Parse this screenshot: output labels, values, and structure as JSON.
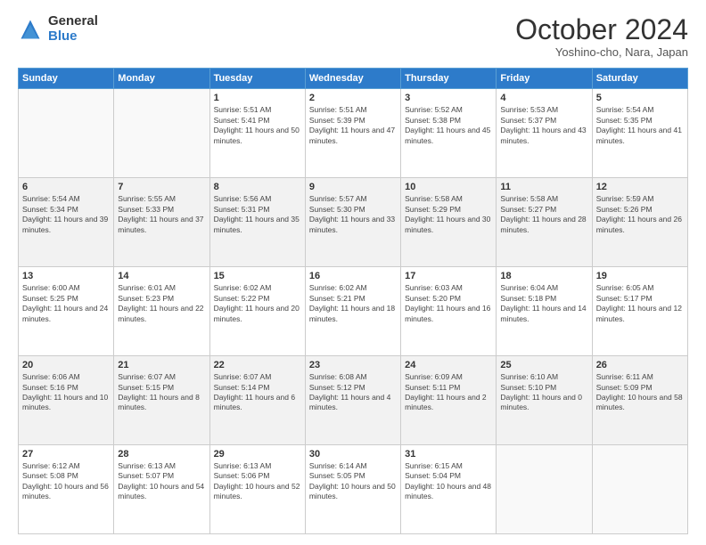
{
  "logo": {
    "general": "General",
    "blue": "Blue"
  },
  "title": "October 2024",
  "location": "Yoshino-cho, Nara, Japan",
  "days_of_week": [
    "Sunday",
    "Monday",
    "Tuesday",
    "Wednesday",
    "Thursday",
    "Friday",
    "Saturday"
  ],
  "weeks": [
    [
      {
        "day": "",
        "sunrise": "",
        "sunset": "",
        "daylight": ""
      },
      {
        "day": "",
        "sunrise": "",
        "sunset": "",
        "daylight": ""
      },
      {
        "day": "1",
        "sunrise": "Sunrise: 5:51 AM",
        "sunset": "Sunset: 5:41 PM",
        "daylight": "Daylight: 11 hours and 50 minutes."
      },
      {
        "day": "2",
        "sunrise": "Sunrise: 5:51 AM",
        "sunset": "Sunset: 5:39 PM",
        "daylight": "Daylight: 11 hours and 47 minutes."
      },
      {
        "day": "3",
        "sunrise": "Sunrise: 5:52 AM",
        "sunset": "Sunset: 5:38 PM",
        "daylight": "Daylight: 11 hours and 45 minutes."
      },
      {
        "day": "4",
        "sunrise": "Sunrise: 5:53 AM",
        "sunset": "Sunset: 5:37 PM",
        "daylight": "Daylight: 11 hours and 43 minutes."
      },
      {
        "day": "5",
        "sunrise": "Sunrise: 5:54 AM",
        "sunset": "Sunset: 5:35 PM",
        "daylight": "Daylight: 11 hours and 41 minutes."
      }
    ],
    [
      {
        "day": "6",
        "sunrise": "Sunrise: 5:54 AM",
        "sunset": "Sunset: 5:34 PM",
        "daylight": "Daylight: 11 hours and 39 minutes."
      },
      {
        "day": "7",
        "sunrise": "Sunrise: 5:55 AM",
        "sunset": "Sunset: 5:33 PM",
        "daylight": "Daylight: 11 hours and 37 minutes."
      },
      {
        "day": "8",
        "sunrise": "Sunrise: 5:56 AM",
        "sunset": "Sunset: 5:31 PM",
        "daylight": "Daylight: 11 hours and 35 minutes."
      },
      {
        "day": "9",
        "sunrise": "Sunrise: 5:57 AM",
        "sunset": "Sunset: 5:30 PM",
        "daylight": "Daylight: 11 hours and 33 minutes."
      },
      {
        "day": "10",
        "sunrise": "Sunrise: 5:58 AM",
        "sunset": "Sunset: 5:29 PM",
        "daylight": "Daylight: 11 hours and 30 minutes."
      },
      {
        "day": "11",
        "sunrise": "Sunrise: 5:58 AM",
        "sunset": "Sunset: 5:27 PM",
        "daylight": "Daylight: 11 hours and 28 minutes."
      },
      {
        "day": "12",
        "sunrise": "Sunrise: 5:59 AM",
        "sunset": "Sunset: 5:26 PM",
        "daylight": "Daylight: 11 hours and 26 minutes."
      }
    ],
    [
      {
        "day": "13",
        "sunrise": "Sunrise: 6:00 AM",
        "sunset": "Sunset: 5:25 PM",
        "daylight": "Daylight: 11 hours and 24 minutes."
      },
      {
        "day": "14",
        "sunrise": "Sunrise: 6:01 AM",
        "sunset": "Sunset: 5:23 PM",
        "daylight": "Daylight: 11 hours and 22 minutes."
      },
      {
        "day": "15",
        "sunrise": "Sunrise: 6:02 AM",
        "sunset": "Sunset: 5:22 PM",
        "daylight": "Daylight: 11 hours and 20 minutes."
      },
      {
        "day": "16",
        "sunrise": "Sunrise: 6:02 AM",
        "sunset": "Sunset: 5:21 PM",
        "daylight": "Daylight: 11 hours and 18 minutes."
      },
      {
        "day": "17",
        "sunrise": "Sunrise: 6:03 AM",
        "sunset": "Sunset: 5:20 PM",
        "daylight": "Daylight: 11 hours and 16 minutes."
      },
      {
        "day": "18",
        "sunrise": "Sunrise: 6:04 AM",
        "sunset": "Sunset: 5:18 PM",
        "daylight": "Daylight: 11 hours and 14 minutes."
      },
      {
        "day": "19",
        "sunrise": "Sunrise: 6:05 AM",
        "sunset": "Sunset: 5:17 PM",
        "daylight": "Daylight: 11 hours and 12 minutes."
      }
    ],
    [
      {
        "day": "20",
        "sunrise": "Sunrise: 6:06 AM",
        "sunset": "Sunset: 5:16 PM",
        "daylight": "Daylight: 11 hours and 10 minutes."
      },
      {
        "day": "21",
        "sunrise": "Sunrise: 6:07 AM",
        "sunset": "Sunset: 5:15 PM",
        "daylight": "Daylight: 11 hours and 8 minutes."
      },
      {
        "day": "22",
        "sunrise": "Sunrise: 6:07 AM",
        "sunset": "Sunset: 5:14 PM",
        "daylight": "Daylight: 11 hours and 6 minutes."
      },
      {
        "day": "23",
        "sunrise": "Sunrise: 6:08 AM",
        "sunset": "Sunset: 5:12 PM",
        "daylight": "Daylight: 11 hours and 4 minutes."
      },
      {
        "day": "24",
        "sunrise": "Sunrise: 6:09 AM",
        "sunset": "Sunset: 5:11 PM",
        "daylight": "Daylight: 11 hours and 2 minutes."
      },
      {
        "day": "25",
        "sunrise": "Sunrise: 6:10 AM",
        "sunset": "Sunset: 5:10 PM",
        "daylight": "Daylight: 11 hours and 0 minutes."
      },
      {
        "day": "26",
        "sunrise": "Sunrise: 6:11 AM",
        "sunset": "Sunset: 5:09 PM",
        "daylight": "Daylight: 10 hours and 58 minutes."
      }
    ],
    [
      {
        "day": "27",
        "sunrise": "Sunrise: 6:12 AM",
        "sunset": "Sunset: 5:08 PM",
        "daylight": "Daylight: 10 hours and 56 minutes."
      },
      {
        "day": "28",
        "sunrise": "Sunrise: 6:13 AM",
        "sunset": "Sunset: 5:07 PM",
        "daylight": "Daylight: 10 hours and 54 minutes."
      },
      {
        "day": "29",
        "sunrise": "Sunrise: 6:13 AM",
        "sunset": "Sunset: 5:06 PM",
        "daylight": "Daylight: 10 hours and 52 minutes."
      },
      {
        "day": "30",
        "sunrise": "Sunrise: 6:14 AM",
        "sunset": "Sunset: 5:05 PM",
        "daylight": "Daylight: 10 hours and 50 minutes."
      },
      {
        "day": "31",
        "sunrise": "Sunrise: 6:15 AM",
        "sunset": "Sunset: 5:04 PM",
        "daylight": "Daylight: 10 hours and 48 minutes."
      },
      {
        "day": "",
        "sunrise": "",
        "sunset": "",
        "daylight": ""
      },
      {
        "day": "",
        "sunrise": "",
        "sunset": "",
        "daylight": ""
      }
    ]
  ]
}
